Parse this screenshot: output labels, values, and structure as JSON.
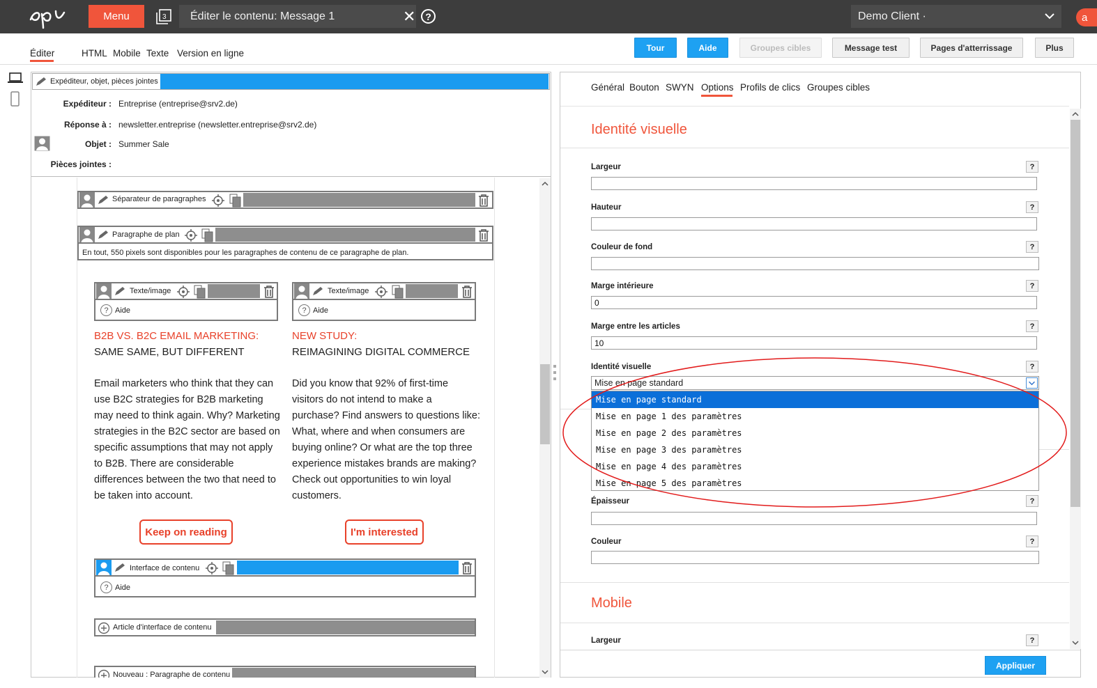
{
  "topbar": {
    "menu_label": "Menu",
    "document_title": "Éditer le contenu: Message 1",
    "pages_count": "3",
    "client": "Demo Client ·",
    "user_initial": "a"
  },
  "subtabs": [
    "Éditer",
    "HTML",
    "Mobile",
    "Texte",
    "Version en ligne"
  ],
  "toolbar": {
    "tour": "Tour",
    "aide": "Aide",
    "groupes_cibles": "Groupes cibles",
    "message_test": "Message test",
    "pages_atterrissage": "Pages d'atterrissage",
    "plus": "Plus"
  },
  "header_block": {
    "bar_label": "Expéditeur, objet, pièces jointes",
    "fields": [
      {
        "label": "Expéditeur :",
        "value": "Entreprise (entreprise@srv2.de)"
      },
      {
        "label": "Réponse à :",
        "value": "newsletter.entreprise (newsletter.entreprise@srv2.de)"
      },
      {
        "label": "Objet :",
        "value": "Summer Sale"
      },
      {
        "label": "Pièces jointes :",
        "value": ""
      }
    ]
  },
  "canvas": {
    "separator_label": "Séparateur de paragraphes",
    "plan_label": "Paragraphe de plan",
    "plan_info": "En tout, 550 pixels sont disponibles pour les paragraphes de contenu de ce paragraphe de plan.",
    "textimage_label": "Texte/image",
    "aide": "Aide",
    "articles": [
      {
        "title_red": "B2B VS. B2C EMAIL MARKETING:",
        "title": "SAME SAME, BUT DIFFERENT",
        "body": "Email marketers who think that they can use B2C strategies for B2B marketing may need to think again. Why? Marketing strategies in the B2C sector are based on specific assumptions that may not apply to B2B. There are considerable differences between the two that need to be taken into account.",
        "cta": "Keep on reading"
      },
      {
        "title_red": "NEW STUDY:",
        "title": "REIMAGINING DIGITAL COMMERCE",
        "body": "Did you know that 92% of first-time visitors do not intend to make a purchase? Find answers to questions like: What, where and when consumers are buying online? Or what are the top three experience mistakes brands are making? Check out opportunities to win loyal customers.",
        "cta": "I'm interested"
      }
    ],
    "interface_label": "Interface de contenu",
    "article_interface_label": "Article d'interface de contenu",
    "new_paragraph_label": "Nouveau : Paragraphe de contenu"
  },
  "right_tabs": [
    "Général",
    "Bouton",
    "SWYN",
    "Options",
    "Profils de clics",
    "Groupes cibles"
  ],
  "identity_section": {
    "title": "Identité visuelle",
    "fields": [
      {
        "label": "Largeur",
        "value": ""
      },
      {
        "label": "Hauteur",
        "value": ""
      },
      {
        "label": "Couleur de fond",
        "value": ""
      },
      {
        "label": "Marge intérieure",
        "value": "0"
      },
      {
        "label": "Marge entre les articles",
        "value": "10"
      }
    ],
    "select_label": "Identité visuelle",
    "select_value": "Mise en page standard",
    "options": [
      "Mise en page standard",
      "Mise en page 1 des paramètres",
      "Mise en page 2 des paramètres",
      "Mise en page 3 des paramètres",
      "Mise en page 4 des paramètres",
      "Mise en page 5 des paramètres"
    ],
    "epaisseur_label": "Épaisseur",
    "couleur_label": "Couleur"
  },
  "mobile_section": {
    "title": "Mobile",
    "largeur_label": "Largeur"
  },
  "help_glyph": "?",
  "apply_label": "Appliquer",
  "colors": {
    "accent": "#f0553b",
    "primary": "#1ea1f2",
    "selection": "#0b6fd9"
  }
}
